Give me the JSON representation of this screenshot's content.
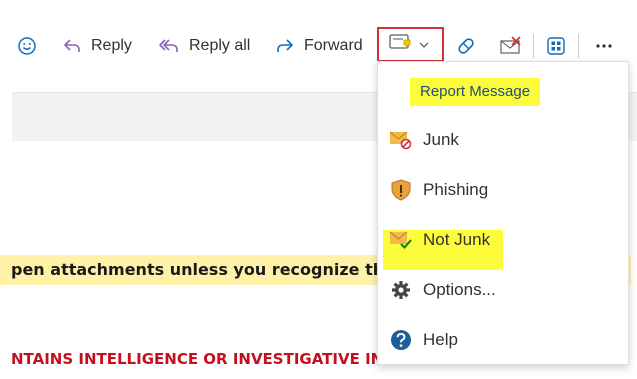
{
  "toolbar": {
    "reply_label": "Reply",
    "reply_all_label": "Reply all",
    "forward_label": "Forward"
  },
  "body": {
    "warning_text": "pen attachments unless you recognize th",
    "classified_text": "NTAINS INTELLIGENCE OR INVESTIGATIVE INFORMATION"
  },
  "dropdown": {
    "header": "Report Message",
    "items": [
      {
        "label": "Junk",
        "icon": "junk-envelope-icon"
      },
      {
        "label": "Phishing",
        "icon": "phishing-shield-icon"
      },
      {
        "label": "Not Junk",
        "icon": "not-junk-envelope-icon"
      },
      {
        "label": "Options...",
        "icon": "gear-icon"
      },
      {
        "label": "Help",
        "icon": "help-icon"
      }
    ]
  },
  "colors": {
    "highlight": "#fcfc3a",
    "report_border": "#d13438",
    "accent": "#0f6cbd",
    "warning_bg": "#fff2a8",
    "classified_text": "#c50f1f"
  }
}
